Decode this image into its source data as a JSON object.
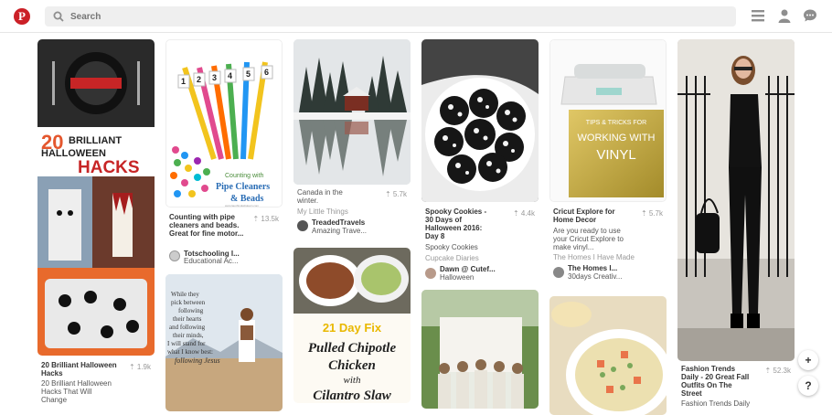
{
  "header": {
    "logo_letter": "P",
    "search_placeholder": "Search",
    "icons": [
      "menu-icon",
      "profile-icon",
      "messages-icon"
    ],
    "brand_color": "#cb2027"
  },
  "pins": {
    "p1": {
      "title": "20 Brilliant Halloween Hacks",
      "desc": "20 Brilliant Halloween Hacks",
      "saves": "1.9k",
      "sub": "20 Brilliant Halloween Hacks That Will Change"
    },
    "p2": {
      "desc": "Counting with pipe cleaners and beads. Great for fine motor...",
      "saves": "13.5k",
      "user": "Totschooling I...",
      "board": "Educational Ac...",
      "img_text": [
        "Counting with",
        "Pipe Cleaners",
        "& Beads"
      ],
      "img_numbers": [
        "1",
        "2",
        "3",
        "4",
        "5",
        "6"
      ],
      "credit": "www.laughingkidslearn.com"
    },
    "p3": {
      "desc": "",
      "saves": "5.7k",
      "sub": "Canada in the winter.",
      "sub2": "My Little Things",
      "user": "TreadedTravels",
      "board": "Amazing Trave..."
    },
    "p4": {
      "desc": "Spooky Cookies - 30 Days of Halloween 2016: Day 8",
      "saves": "4.4k",
      "sub": "Spooky Cookies",
      "sub2": "Cupcake Diaries",
      "user": "Dawn @ Cutef...",
      "board": "Halloween"
    },
    "p5": {
      "desc": "Cricut Explore for Home Decor",
      "saves": "5.7k",
      "sub": "Are you ready to use your Cricut Explore to make vinyl...",
      "sub2": "The Homes I Have Made",
      "user": "The Homes I...",
      "board": "30days Creativ...",
      "img_text": [
        "TIPS & TRICKS FOR",
        "WORKING WITH",
        "VINYL"
      ]
    },
    "p6": {
      "desc": "Fashion Trends Daily - 20 Great Fall Outfits On The Street",
      "saves": "52.3k",
      "sub": "Fashion Trends Daily"
    },
    "p7": {
      "img_text": [
        "While they",
        "pick between",
        "following",
        "their hearts",
        "and following",
        "their minds,",
        "I will stand for",
        "what I know best:",
        "following Jesus"
      ]
    },
    "p8": {
      "img_text": [
        "21 Day Fix",
        "Pulled Chipotle",
        "Chicken",
        "with",
        "Cilantro Slaw"
      ]
    }
  },
  "fab": {
    "add": "+",
    "help": "?"
  }
}
